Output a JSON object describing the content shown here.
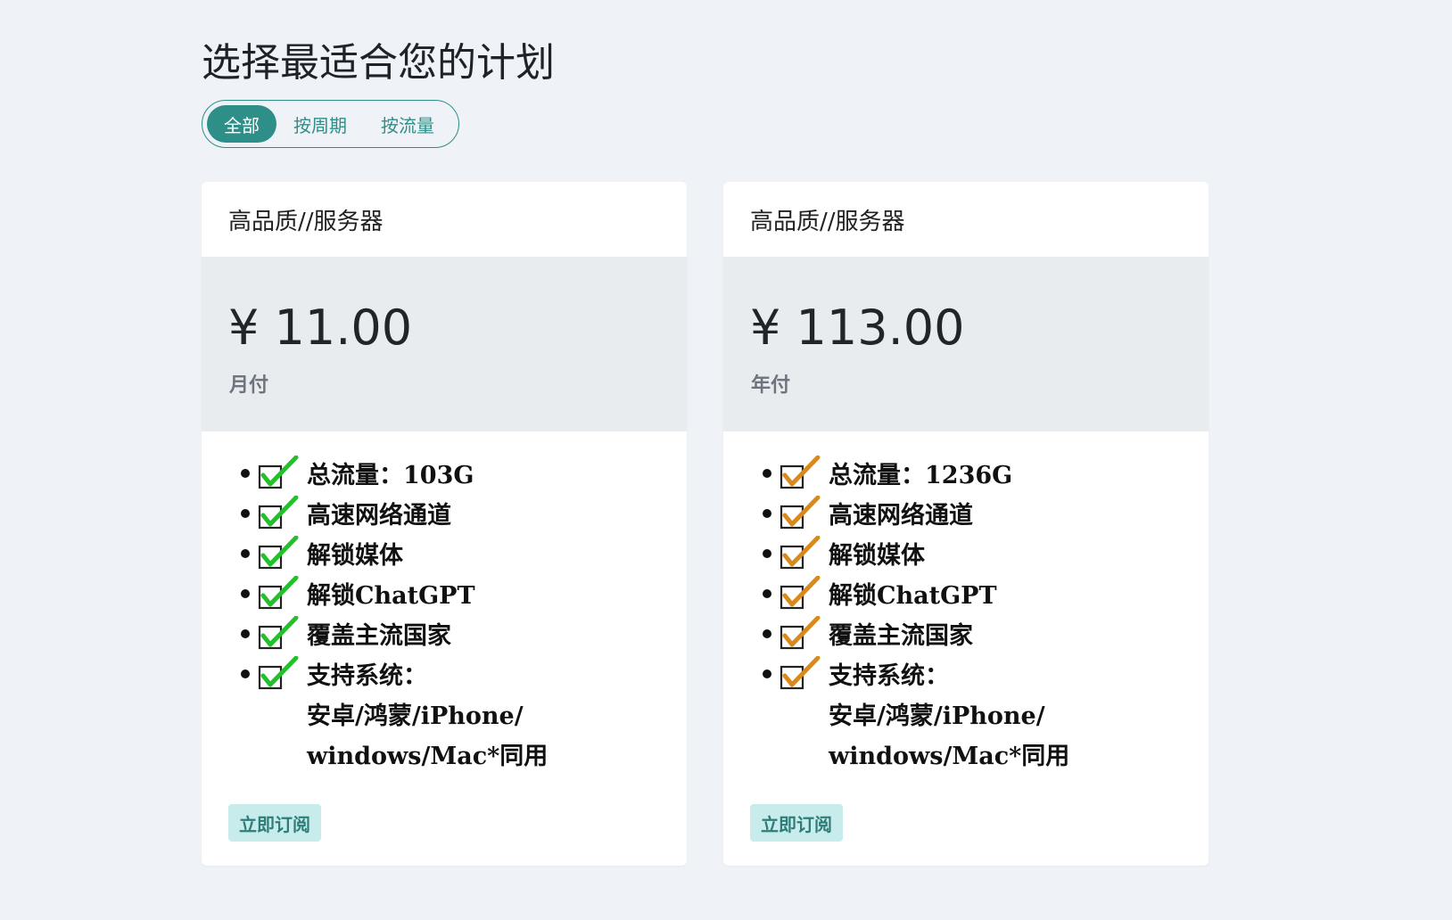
{
  "page": {
    "title": "选择最适合您的计划"
  },
  "filters": [
    {
      "label": "全部",
      "active": true
    },
    {
      "label": "按周期",
      "active": false
    },
    {
      "label": "按流量",
      "active": false
    }
  ],
  "plans": [
    {
      "header": "高品质//服务器",
      "price": "¥ 11.00",
      "period": "月付",
      "check_color": "#22c02a",
      "features": [
        "总流量：103G",
        "高速网络通道",
        "解锁媒体",
        "解锁ChatGPT",
        "覆盖主流国家",
        "支持系统："
      ],
      "feature_cont": [
        "安卓/鸿蒙/iPhone/",
        "windows/Mac*同用"
      ],
      "button_label": "立即订阅"
    },
    {
      "header": "高品质//服务器",
      "price": "¥ 113.00",
      "period": "年付",
      "check_color": "#d98a1c",
      "features": [
        "总流量：1236G",
        "高速网络通道",
        "解锁媒体",
        "解锁ChatGPT",
        "覆盖主流国家",
        "支持系统："
      ],
      "feature_cont": [
        "安卓/鸿蒙/iPhone/",
        "windows/Mac*同用"
      ],
      "button_label": "立即订阅"
    }
  ],
  "colors": {
    "accent": "#2e8f88",
    "background": "#eff2f6",
    "price_band": "#e9ecef",
    "button_bg": "#c8ecec"
  },
  "icons": {
    "feature_check": "checkbox-check-icon"
  }
}
